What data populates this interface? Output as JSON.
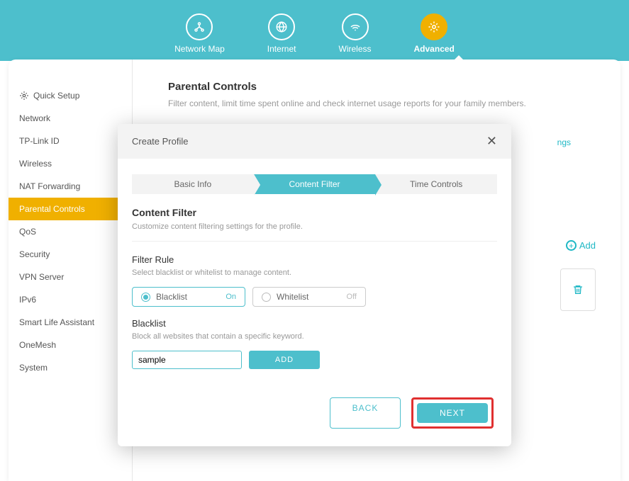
{
  "nav": {
    "items": [
      {
        "label": "Network Map",
        "icon": "network"
      },
      {
        "label": "Internet",
        "icon": "globe"
      },
      {
        "label": "Wireless",
        "icon": "wifi"
      },
      {
        "label": "Advanced",
        "icon": "gear",
        "active": true
      }
    ]
  },
  "sidebar": {
    "items": [
      {
        "label": "Quick Setup",
        "icon": "gear"
      },
      {
        "label": "Network"
      },
      {
        "label": "TP-Link ID"
      },
      {
        "label": "Wireless"
      },
      {
        "label": "NAT Forwarding"
      },
      {
        "label": "Parental Controls",
        "active": true
      },
      {
        "label": "QoS"
      },
      {
        "label": "Security"
      },
      {
        "label": "VPN Server"
      },
      {
        "label": "IPv6"
      },
      {
        "label": "Smart Life Assistant"
      },
      {
        "label": "OneMesh"
      },
      {
        "label": "System"
      }
    ]
  },
  "page": {
    "title": "Parental Controls",
    "desc": "Filter content, limit time spent online and check internet usage reports for your family members.",
    "peek": "ngs",
    "add_label": "Add"
  },
  "modal": {
    "title": "Create Profile",
    "steps": [
      "Basic Info",
      "Content Filter",
      "Time Controls"
    ],
    "section_title": "Content Filter",
    "section_desc": "Customize content filtering settings for the profile.",
    "filter_rule_title": "Filter Rule",
    "filter_rule_desc": "Select blacklist or whitelist to manage content.",
    "blacklist_label": "Blacklist",
    "whitelist_label": "Whitelist",
    "on_label": "On",
    "off_label": "Off",
    "blacklist_title": "Blacklist",
    "blacklist_desc": "Block all websites that contain a specific keyword.",
    "keyword_value": "sample",
    "add_btn": "ADD",
    "back_btn": "BACK",
    "next_btn": "NEXT"
  }
}
